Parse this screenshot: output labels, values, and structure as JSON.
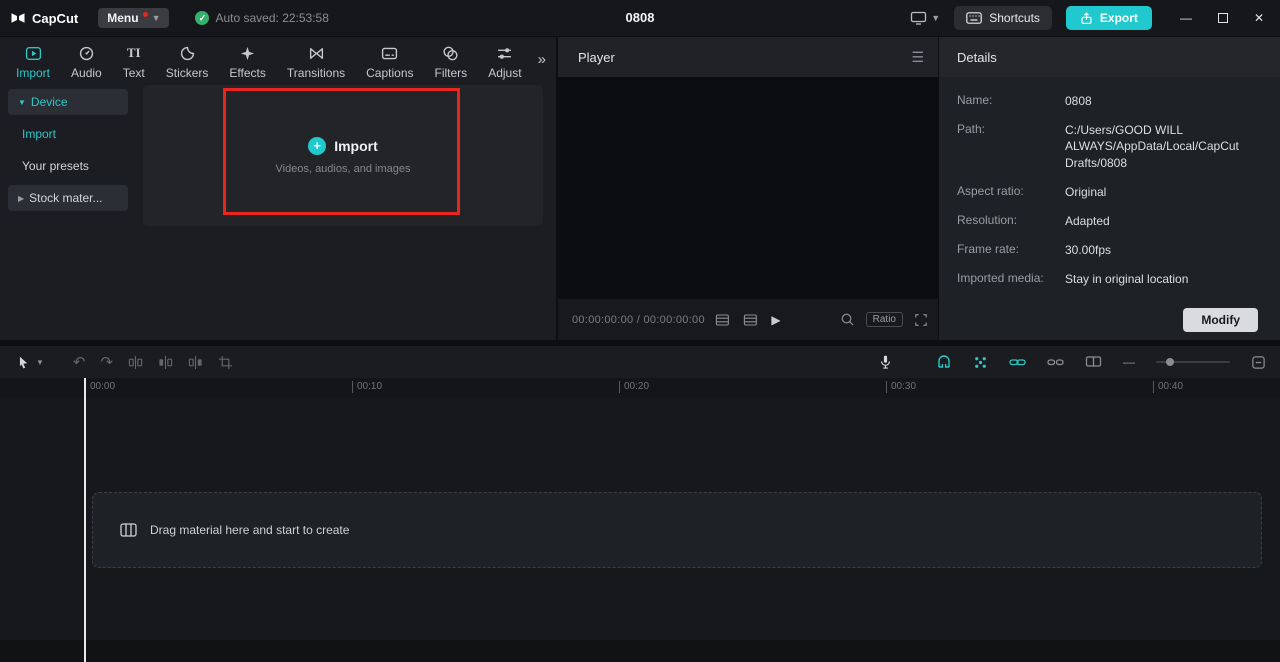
{
  "colors": {
    "accent": "#2cc8c6",
    "export_button": "#1fc9ce",
    "highlight_red": "#e8251f",
    "autosave_green": "#35b06f"
  },
  "titlebar": {
    "app_name": "CapCut",
    "menu_label": "Menu",
    "autosave_text": "Auto saved: 22:53:58",
    "project_title": "0808",
    "shortcuts_label": "Shortcuts",
    "export_label": "Export"
  },
  "media_panel": {
    "tabs": [
      {
        "label": "Import",
        "icon": "import-icon",
        "active": true
      },
      {
        "label": "Audio",
        "icon": "audio-icon"
      },
      {
        "label": "Text",
        "icon": "text-icon"
      },
      {
        "label": "Stickers",
        "icon": "stickers-icon"
      },
      {
        "label": "Effects",
        "icon": "effects-icon"
      },
      {
        "label": "Transitions",
        "icon": "transitions-icon"
      },
      {
        "label": "Captions",
        "icon": "captions-icon"
      },
      {
        "label": "Filters",
        "icon": "filters-icon"
      },
      {
        "label": "Adjust",
        "icon": "adjust-icon"
      }
    ],
    "sidebar": [
      {
        "label": "Device",
        "state": "expanded"
      },
      {
        "label": "Import",
        "state": "selected"
      },
      {
        "label": "Your presets"
      },
      {
        "label": "Stock mater..."
      }
    ],
    "import_zone": {
      "title": "Import",
      "subtitle": "Videos, audios, and images"
    }
  },
  "player": {
    "title": "Player",
    "timecode": "00:00:00:00 / 00:00:00:00",
    "ratio_label": "Ratio"
  },
  "details": {
    "title": "Details",
    "rows": [
      {
        "label": "Name:",
        "value": "0808"
      },
      {
        "label": "Path:",
        "value": "C:/Users/GOOD WILL ALWAYS/AppData/Local/CapCut Drafts/0808"
      },
      {
        "label": "Aspect ratio:",
        "value": "Original"
      },
      {
        "label": "Resolution:",
        "value": "Adapted"
      },
      {
        "label": "Frame rate:",
        "value": "30.00fps"
      },
      {
        "label": "Imported media:",
        "value": "Stay in original location"
      }
    ],
    "modify_label": "Modify"
  },
  "toolbar_icons": [
    "select-tool-icon",
    "dropdown-caret-icon",
    "undo-icon",
    "redo-icon",
    "split-icon",
    "delete-left-icon",
    "delete-right-icon",
    "crop-icon",
    "mic-icon",
    "magnet-icon",
    "snapping-icon",
    "link-icon",
    "unlink-icon",
    "preview-axis-icon",
    "zoom-out-icon",
    "zoom-slider",
    "zoom-to-fit-icon"
  ],
  "timeline": {
    "ruler_labels": [
      "00:00",
      "00:10",
      "00:20",
      "00:30",
      "00:40"
    ],
    "drop_hint": "Drag material here and start to create"
  }
}
